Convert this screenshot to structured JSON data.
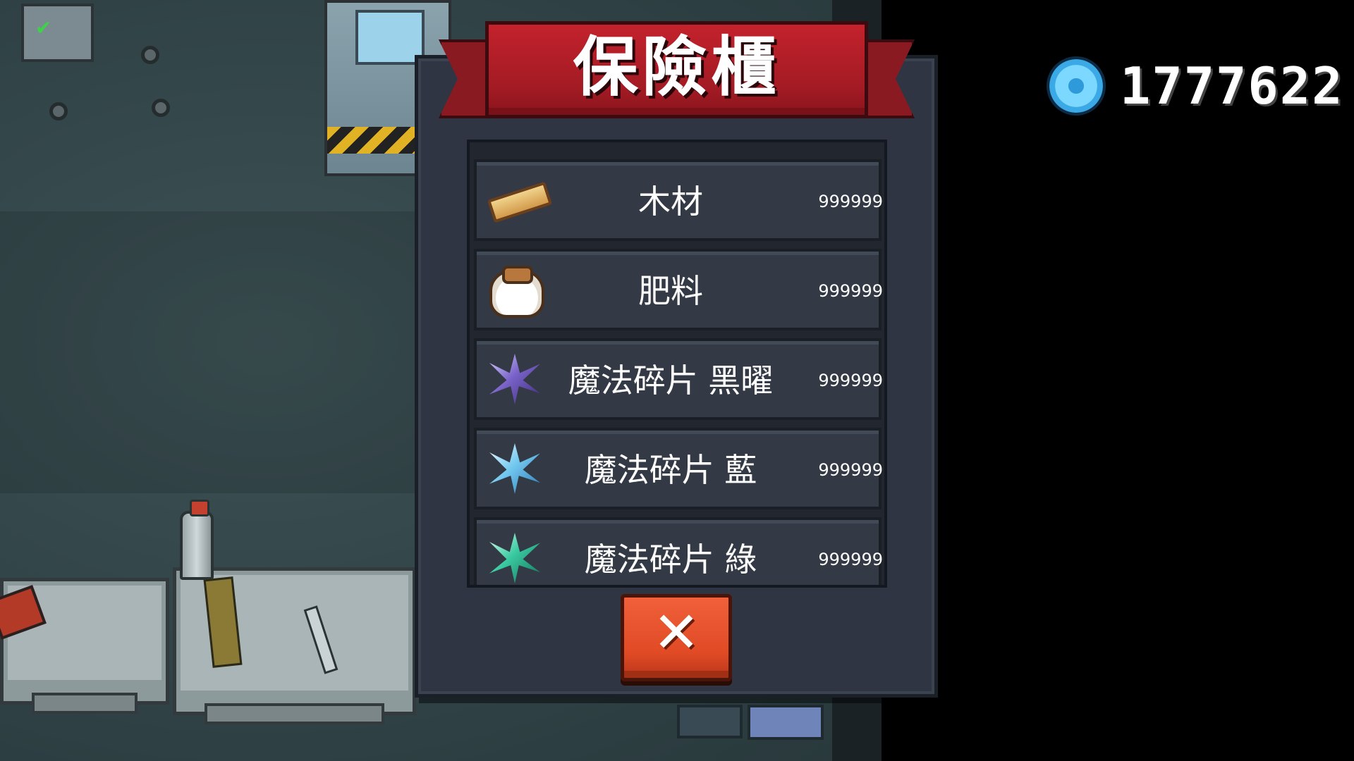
{
  "currency": {
    "icon": "gem-icon",
    "amount": "1777622"
  },
  "vault": {
    "title": "保險櫃",
    "items": [
      {
        "name": "木材",
        "count": "999999",
        "icon": "wood-icon"
      },
      {
        "name": "肥料",
        "count": "999999",
        "icon": "fertilizer-bag-icon"
      },
      {
        "name": "魔法碎片 黑曜",
        "count": "999999",
        "icon": "magic-shard-obsidian-icon"
      },
      {
        "name": "魔法碎片 藍",
        "count": "999999",
        "icon": "magic-shard-blue-icon"
      },
      {
        "name": "魔法碎片 綠",
        "count": "999999",
        "icon": "magic-shard-green-icon"
      }
    ],
    "close_icon": "close-icon",
    "close_symbol": "✕"
  },
  "colors": {
    "banner_red": "#a31b24",
    "panel_bg": "#2f3542",
    "close_button": "#e04a25",
    "gem_blue": "#7dd8ff"
  }
}
